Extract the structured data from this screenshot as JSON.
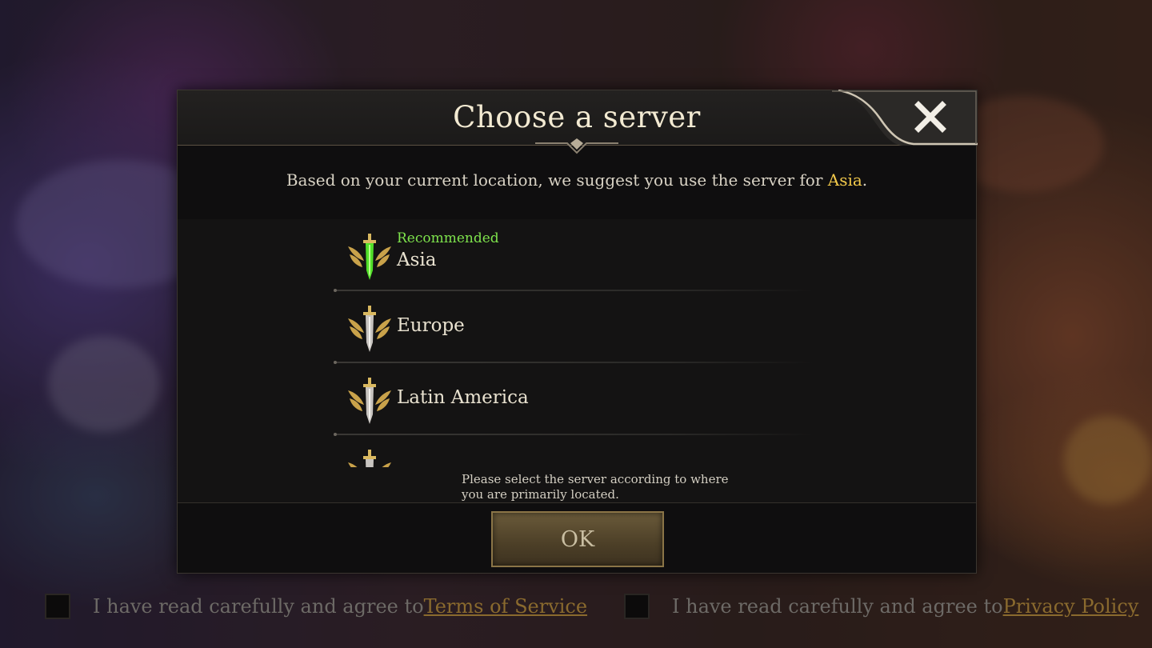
{
  "dialog": {
    "title": "Choose a server",
    "suggestion_prefix": "Based on your current location, we suggest you use the server for ",
    "suggestion_region": "Asia",
    "suggestion_suffix": ".",
    "servers": [
      {
        "tag": "Recommended",
        "name": "Asia",
        "selected": true
      },
      {
        "tag": "",
        "name": "Europe",
        "selected": false
      },
      {
        "tag": "",
        "name": "Latin America",
        "selected": false
      }
    ],
    "note": "Please select the server according to where you are primarily located.",
    "ok_label": "OK"
  },
  "consent": {
    "terms_text": "I have read carefully and agree to",
    "terms_link": "Terms of Service",
    "privacy_text": "I have read carefully and agree to",
    "privacy_link": "Privacy Policy"
  },
  "colors": {
    "highlight": "#f1c84a",
    "recommended": "#7ee34c",
    "gold": "#c9a24a"
  }
}
